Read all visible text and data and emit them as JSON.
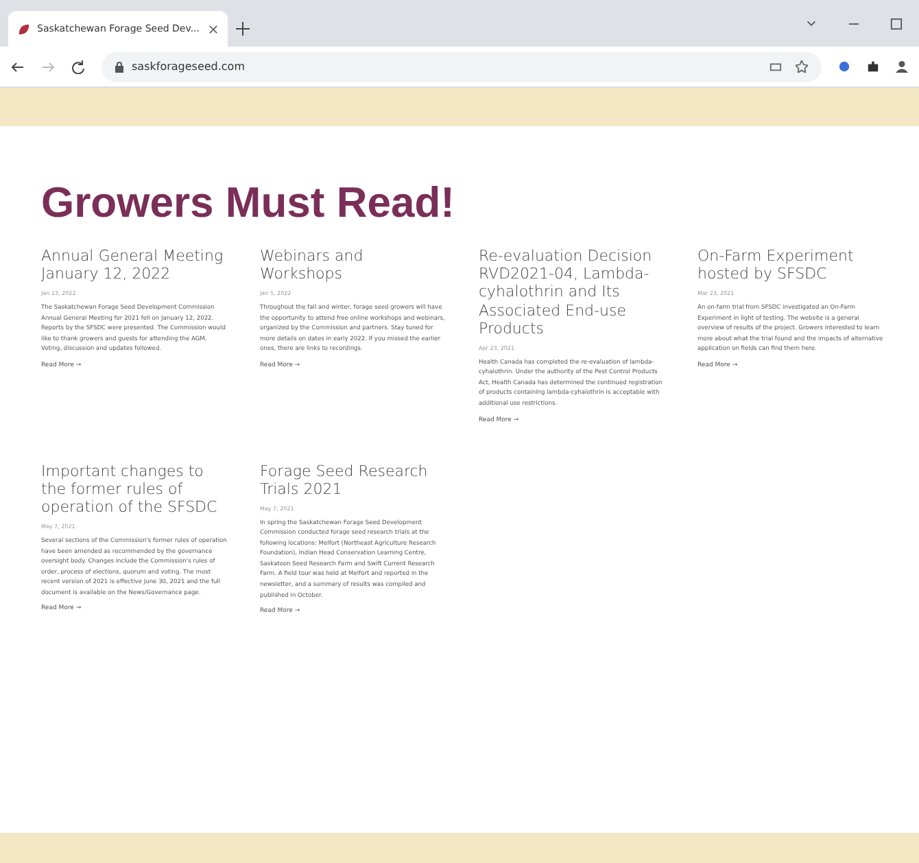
{
  "browser": {
    "tab_title": "Saskatchewan Forage Seed Dev...",
    "url": "saskforageseed.com"
  },
  "heading": "Growers Must Read!",
  "posts": [
    {
      "title": "Annual General Meeting January 12, 2022",
      "date": "Jan 13, 2022",
      "excerpt": "The Saskatchewan Forage Seed Development Commission Annual General Meeting for 2021 fell on January 12, 2022. Reports by the SFSDC were presented. The Commission would like to thank growers and guests for attending the AGM. Voting, discussion and updates followed.",
      "link": "Read More →"
    },
    {
      "title": "Webinars and Workshops",
      "date": "Jan 5, 2022",
      "excerpt": "Throughout the fall and winter, forage seed growers will have the opportunity to attend free online workshops and webinars, organized by the Commission and partners. Stay tuned for more details on dates in early 2022. If you missed the earlier ones, there are links to recordings.",
      "link": "Read More →"
    },
    {
      "title": "Re-evaluation Decision RVD2021-04, Lambda-cyhalothrin and Its Associated End-use Products",
      "date": "Apr 23, 2021",
      "excerpt": "Health Canada has completed the re-evaluation of lambda-cyhalothrin. Under the authority of the Pest Control Products Act, Health Canada has determined the continued registration of products containing lambda-cyhalothrin is acceptable with additional use restrictions.",
      "link": "Read More →"
    },
    {
      "title": "On-Farm Experiment hosted by SFSDC",
      "date": "Mar 23, 2021",
      "excerpt": "An on-farm trial from SFSDC investigated an On-Farm Experiment in light of testing. The website is a general overview of results of the project. Growers interested to learn more about what the trial found and the impacts of alternative application on fields can find them here.",
      "link": "Read More →"
    },
    {
      "title": "Important changes to the former rules of operation of the SFSDC",
      "date": "May 7, 2021",
      "excerpt": "Several sections of the Commission's former rules of operation have been amended as recommended by the governance oversight body. Changes include the Commission's rules of order, process of elections, quorum and voting. The most recent version of 2021 is effective June 30, 2021 and the full document is available on the News/Governance page.",
      "link": "Read More →"
    },
    {
      "title": "Forage Seed Research Trials 2021",
      "date": "May 7, 2021",
      "excerpt": "In spring the Saskatchewan Forage Seed Development Commission conducted forage seed research trials at the following locations: Melfort (Northeast Agriculture Research Foundation), Indian Head Conservation Learning Centre, Saskatoon Seed Research Farm and Swift Current Research Farm. A field tour was held at Melfort and reported in the newsletter, and a summary of results was compiled and published in October.",
      "link": "Read More →"
    }
  ]
}
